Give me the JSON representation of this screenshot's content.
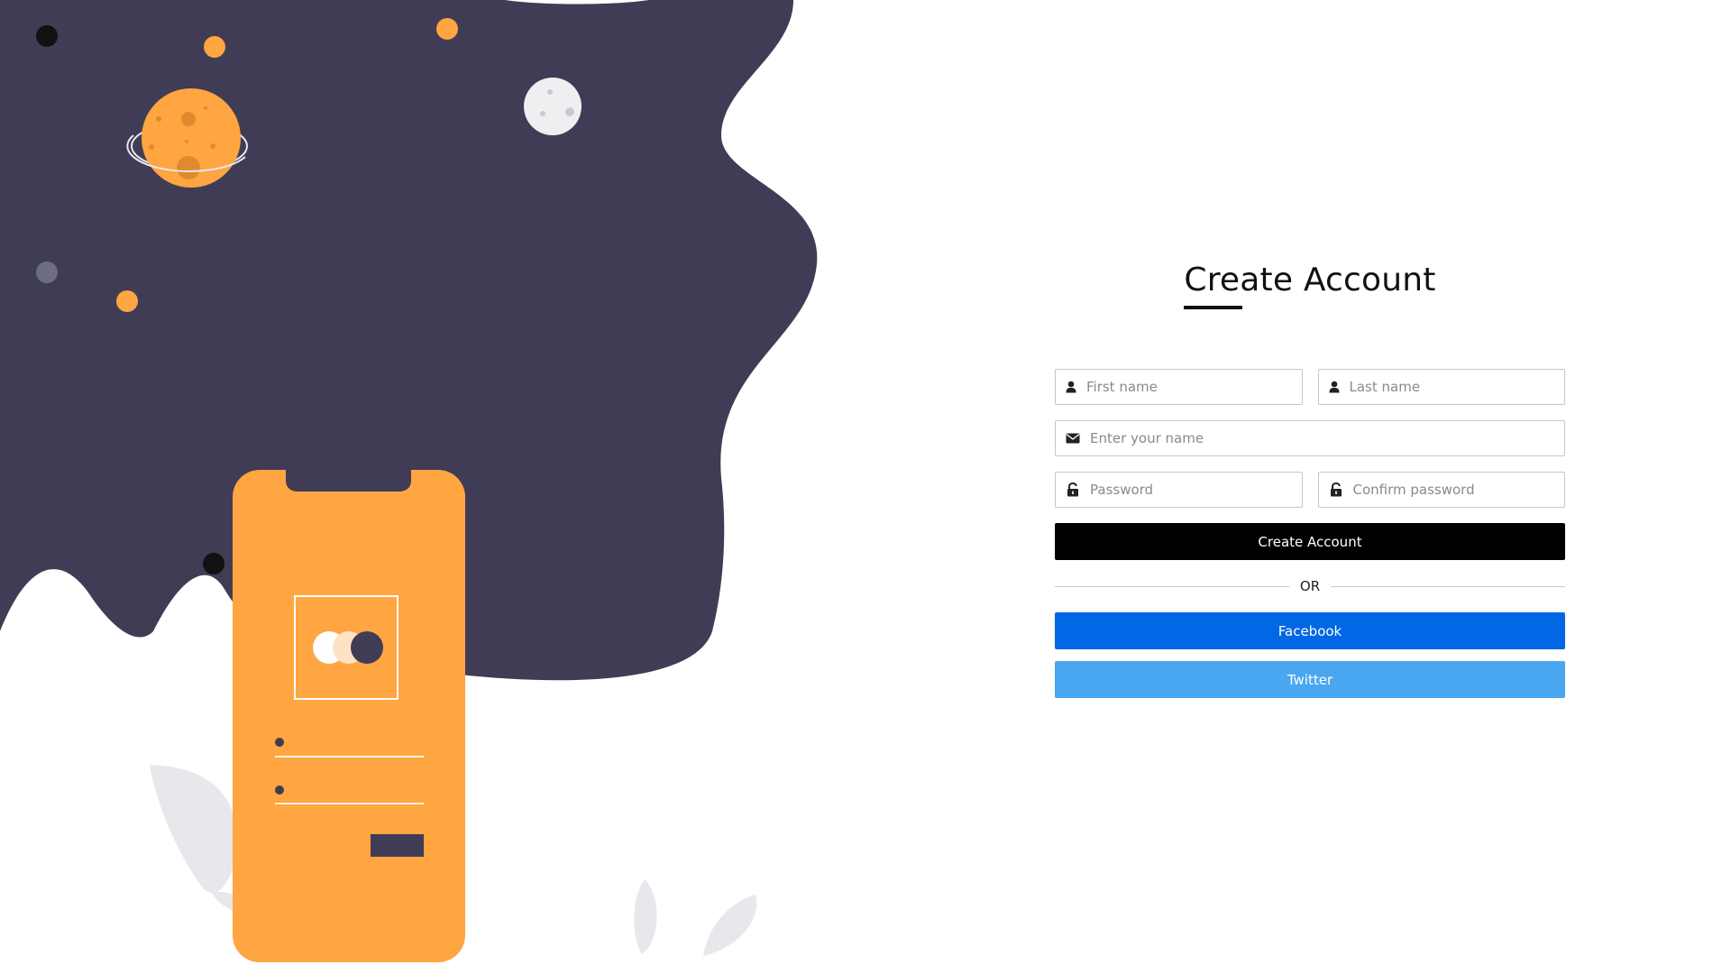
{
  "form": {
    "title": "Create Account",
    "first_name_placeholder": "First name",
    "last_name_placeholder": "Last name",
    "email_placeholder": "Enter your name",
    "password_placeholder": "Password",
    "confirm_password_placeholder": "Confirm password",
    "submit_label": "Create Account",
    "divider_label": "OR",
    "facebook_label": "Facebook",
    "twitter_label": "Twitter"
  },
  "colors": {
    "illustration_dark": "#403c55",
    "illustration_orange": "#ffa541",
    "primary_button": "#000000",
    "facebook": "#0167e4",
    "twitter": "#49a7f1"
  },
  "icons": {
    "first_name": "user-icon",
    "last_name": "user-icon",
    "email": "envelope-icon",
    "password": "lock-icon",
    "confirm_password": "lock-icon"
  }
}
